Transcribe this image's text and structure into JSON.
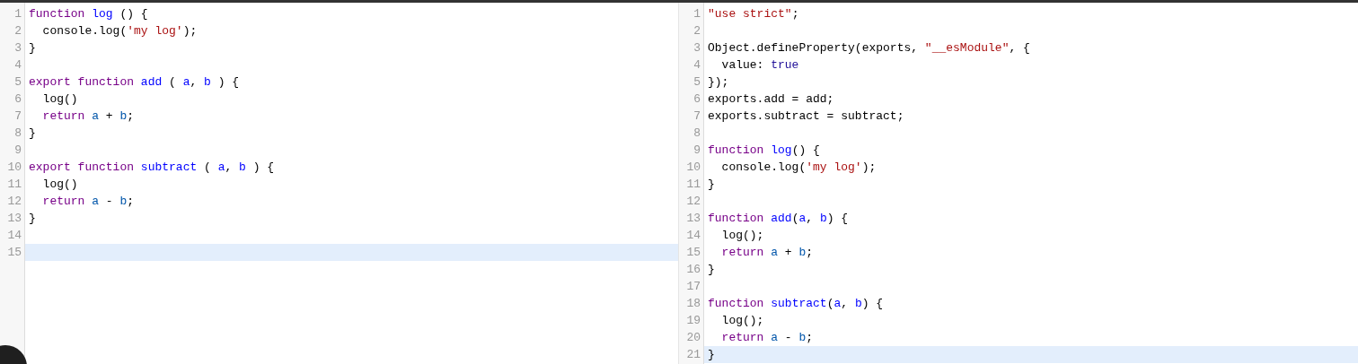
{
  "panes": [
    {
      "lines": [
        {
          "number": "1",
          "active": false,
          "tokens": [
            {
              "kind": "keyword",
              "text": "function"
            },
            {
              "kind": "def",
              "text": " log"
            },
            {
              "kind": "plain",
              "text": " () {"
            }
          ]
        },
        {
          "number": "2",
          "active": false,
          "tokens": [
            {
              "kind": "plain",
              "text": "  console.log("
            },
            {
              "kind": "string",
              "text": "'my log'"
            },
            {
              "kind": "plain",
              "text": ");"
            }
          ]
        },
        {
          "number": "3",
          "active": false,
          "tokens": [
            {
              "kind": "plain",
              "text": "}"
            }
          ]
        },
        {
          "number": "4",
          "active": false
        },
        {
          "number": "5",
          "active": false,
          "tokens": [
            {
              "kind": "keyword",
              "text": "export"
            },
            {
              "kind": "keyword",
              "text": " function"
            },
            {
              "kind": "def",
              "text": " add"
            },
            {
              "kind": "plain",
              "text": " ( "
            },
            {
              "kind": "def",
              "text": "a"
            },
            {
              "kind": "plain",
              "text": ", "
            },
            {
              "kind": "def",
              "text": "b"
            },
            {
              "kind": "plain",
              "text": " ) {"
            }
          ]
        },
        {
          "number": "6",
          "active": false,
          "tokens": [
            {
              "kind": "plain",
              "text": "  log()"
            }
          ]
        },
        {
          "number": "7",
          "active": false,
          "tokens": [
            {
              "kind": "keyword",
              "text": "  return"
            },
            {
              "kind": "variable",
              "text": " a"
            },
            {
              "kind": "plain",
              "text": " + "
            },
            {
              "kind": "variable",
              "text": "b"
            },
            {
              "kind": "plain",
              "text": ";"
            }
          ]
        },
        {
          "number": "8",
          "active": false,
          "tokens": [
            {
              "kind": "plain",
              "text": "}"
            }
          ]
        },
        {
          "number": "9",
          "active": false
        },
        {
          "number": "10",
          "active": false,
          "tokens": [
            {
              "kind": "keyword",
              "text": "export"
            },
            {
              "kind": "keyword",
              "text": " function"
            },
            {
              "kind": "def",
              "text": " subtract"
            },
            {
              "kind": "plain",
              "text": " ( "
            },
            {
              "kind": "def",
              "text": "a"
            },
            {
              "kind": "plain",
              "text": ", "
            },
            {
              "kind": "def",
              "text": "b"
            },
            {
              "kind": "plain",
              "text": " ) {"
            }
          ]
        },
        {
          "number": "11",
          "active": false,
          "tokens": [
            {
              "kind": "plain",
              "text": "  log()"
            }
          ]
        },
        {
          "number": "12",
          "active": false,
          "tokens": [
            {
              "kind": "keyword",
              "text": "  return"
            },
            {
              "kind": "variable",
              "text": " a"
            },
            {
              "kind": "plain",
              "text": " - "
            },
            {
              "kind": "variable",
              "text": "b"
            },
            {
              "kind": "plain",
              "text": ";"
            }
          ]
        },
        {
          "number": "13",
          "active": false,
          "tokens": [
            {
              "kind": "plain",
              "text": "}"
            }
          ]
        },
        {
          "number": "14",
          "active": false
        },
        {
          "number": "15",
          "active": true
        }
      ]
    },
    {
      "lines": [
        {
          "number": "1",
          "active": false,
          "tokens": [
            {
              "kind": "string",
              "text": "\"use strict\""
            },
            {
              "kind": "plain",
              "text": ";"
            }
          ]
        },
        {
          "number": "2",
          "active": false
        },
        {
          "number": "3",
          "active": false,
          "tokens": [
            {
              "kind": "plain",
              "text": "Object.defineProperty(exports, "
            },
            {
              "kind": "string",
              "text": "\"__esModule\""
            },
            {
              "kind": "plain",
              "text": ", {"
            }
          ]
        },
        {
          "number": "4",
          "active": false,
          "tokens": [
            {
              "kind": "plain",
              "text": "  value: "
            },
            {
              "kind": "atom",
              "text": "true"
            }
          ]
        },
        {
          "number": "5",
          "active": false,
          "tokens": [
            {
              "kind": "plain",
              "text": "});"
            }
          ]
        },
        {
          "number": "6",
          "active": false,
          "tokens": [
            {
              "kind": "plain",
              "text": "exports.add = add;"
            }
          ]
        },
        {
          "number": "7",
          "active": false,
          "tokens": [
            {
              "kind": "plain",
              "text": "exports.subtract = subtract;"
            }
          ]
        },
        {
          "number": "8",
          "active": false
        },
        {
          "number": "9",
          "active": false,
          "tokens": [
            {
              "kind": "keyword",
              "text": "function"
            },
            {
              "kind": "def",
              "text": " log"
            },
            {
              "kind": "plain",
              "text": "() {"
            }
          ]
        },
        {
          "number": "10",
          "active": false,
          "tokens": [
            {
              "kind": "plain",
              "text": "  console.log("
            },
            {
              "kind": "string",
              "text": "'my log'"
            },
            {
              "kind": "plain",
              "text": ");"
            }
          ]
        },
        {
          "number": "11",
          "active": false,
          "tokens": [
            {
              "kind": "plain",
              "text": "}"
            }
          ]
        },
        {
          "number": "12",
          "active": false
        },
        {
          "number": "13",
          "active": false,
          "tokens": [
            {
              "kind": "keyword",
              "text": "function"
            },
            {
              "kind": "def",
              "text": " add"
            },
            {
              "kind": "plain",
              "text": "("
            },
            {
              "kind": "def",
              "text": "a"
            },
            {
              "kind": "plain",
              "text": ", "
            },
            {
              "kind": "def",
              "text": "b"
            },
            {
              "kind": "plain",
              "text": ") {"
            }
          ]
        },
        {
          "number": "14",
          "active": false,
          "tokens": [
            {
              "kind": "plain",
              "text": "  log();"
            }
          ]
        },
        {
          "number": "15",
          "active": false,
          "tokens": [
            {
              "kind": "keyword",
              "text": "  return"
            },
            {
              "kind": "variable",
              "text": " a"
            },
            {
              "kind": "plain",
              "text": " + "
            },
            {
              "kind": "variable",
              "text": "b"
            },
            {
              "kind": "plain",
              "text": ";"
            }
          ]
        },
        {
          "number": "16",
          "active": false,
          "tokens": [
            {
              "kind": "plain",
              "text": "}"
            }
          ]
        },
        {
          "number": "17",
          "active": false
        },
        {
          "number": "18",
          "active": false,
          "tokens": [
            {
              "kind": "keyword",
              "text": "function"
            },
            {
              "kind": "def",
              "text": " subtract"
            },
            {
              "kind": "plain",
              "text": "("
            },
            {
              "kind": "def",
              "text": "a"
            },
            {
              "kind": "plain",
              "text": ", "
            },
            {
              "kind": "def",
              "text": "b"
            },
            {
              "kind": "plain",
              "text": ") {"
            }
          ]
        },
        {
          "number": "19",
          "active": false,
          "tokens": [
            {
              "kind": "plain",
              "text": "  log();"
            }
          ]
        },
        {
          "number": "20",
          "active": false,
          "tokens": [
            {
              "kind": "keyword",
              "text": "  return"
            },
            {
              "kind": "variable",
              "text": " a"
            },
            {
              "kind": "plain",
              "text": " - "
            },
            {
              "kind": "variable",
              "text": "b"
            },
            {
              "kind": "plain",
              "text": ";"
            }
          ]
        },
        {
          "number": "21",
          "active": true,
          "tokens": [
            {
              "kind": "plain",
              "text": "}"
            }
          ]
        }
      ]
    }
  ]
}
